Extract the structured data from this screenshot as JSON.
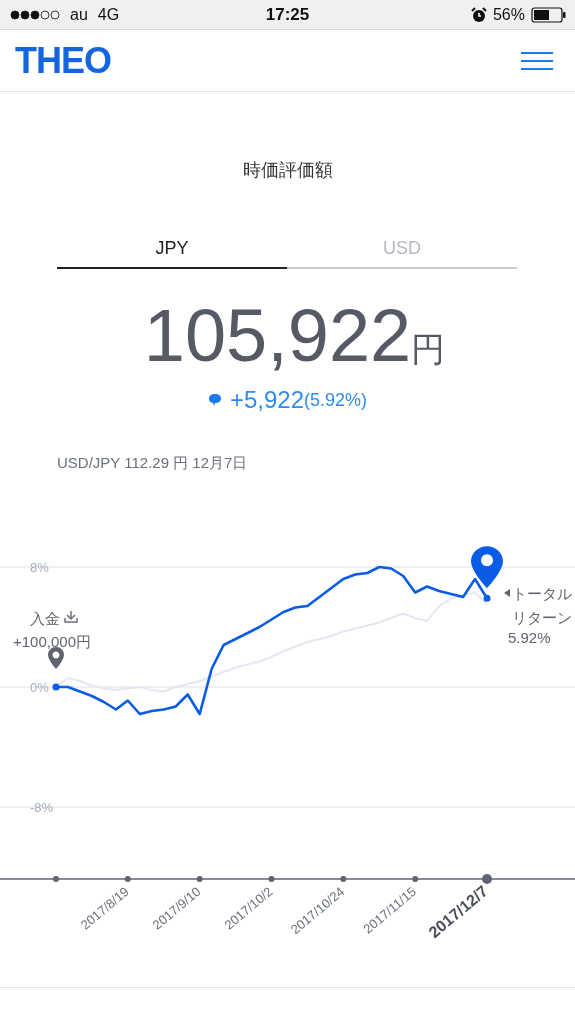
{
  "status_bar": {
    "carrier": "au",
    "network": "4G",
    "time": "17:25",
    "battery": "56%"
  },
  "header": {
    "logo": "THEO"
  },
  "title": "時価評価額",
  "tabs": [
    {
      "label": "JPY",
      "selected": true
    },
    {
      "label": "USD",
      "selected": false
    }
  ],
  "valuation": {
    "amount": "105,922",
    "unit": "円",
    "change": "+5,922",
    "change_percent": "(5.92%)"
  },
  "fx_rate": "USD/JPY 112.29 円 12月7日",
  "chart": {
    "deposit": {
      "label": "入金",
      "amount": "+100,000円"
    },
    "total_return": {
      "label_lines": [
        "トータル",
        "リターン"
      ],
      "value": "5.92%"
    },
    "chart_data": {
      "type": "line",
      "categories": [
        null,
        null,
        null,
        null,
        null,
        null,
        "2017/8/19",
        null,
        null,
        null,
        null,
        null,
        "2017/9/10",
        null,
        null,
        null,
        null,
        null,
        "2017/10/2",
        null,
        null,
        null,
        null,
        null,
        "2017/10/24",
        null,
        null,
        null,
        null,
        null,
        "2017/11/15",
        null,
        null,
        null,
        null,
        null,
        "2017/12/7"
      ],
      "series": [
        {
          "color": "#0a5ce6",
          "values": [
            0,
            0,
            -0.3,
            -0.6,
            -1.0,
            -1.5,
            -0.9,
            -1.8,
            -1.6,
            -1.5,
            -1.3,
            -0.5,
            -1.8,
            1.2,
            2.8,
            3.2,
            3.6,
            4.0,
            4.5,
            5.0,
            5.3,
            5.4,
            6.0,
            6.6,
            7.2,
            7.5,
            7.6,
            8.0,
            7.9,
            7.4,
            6.3,
            6.7,
            6.4,
            6.2,
            6.0,
            7.2,
            5.92
          ]
        },
        {
          "color": "#e3e8f0",
          "values": [
            0,
            0.6,
            0.4,
            0.1,
            -0.1,
            -0.2,
            -0.1,
            0,
            -0.2,
            -0.3,
            0,
            0.2,
            0.4,
            0.7,
            1.0,
            1.3,
            1.5,
            1.7,
            2.0,
            2.4,
            2.7,
            3.0,
            3.2,
            3.4,
            3.7,
            3.9,
            4.1,
            4.3,
            4.6,
            4.9,
            4.6,
            4.4,
            5.4,
            5.9,
            6.1,
            6.3,
            5.5
          ]
        }
      ],
      "grid": true,
      "ylim": [
        -12.8,
        8
      ],
      "yticks": [
        {
          "value": 8,
          "label": "8%"
        },
        {
          "value": 0,
          "label": "0%"
        },
        {
          "value": -8,
          "label": "-8%"
        }
      ]
    }
  }
}
